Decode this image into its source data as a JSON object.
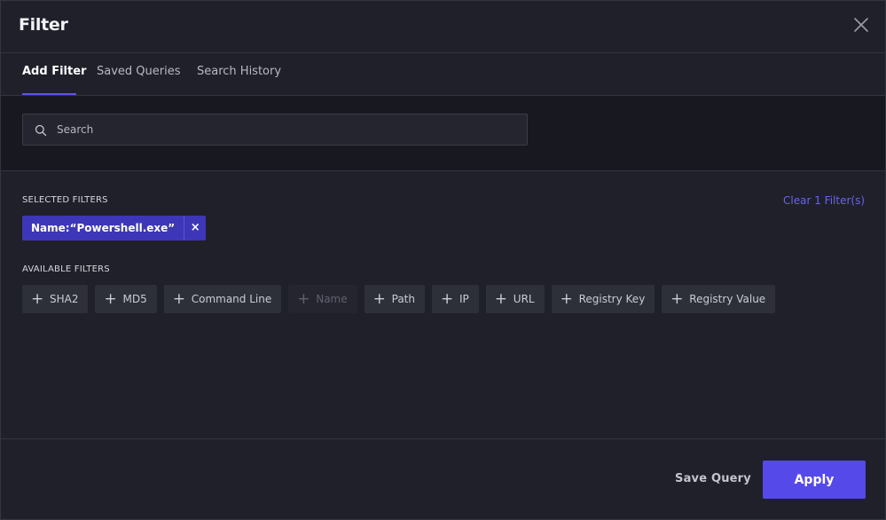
{
  "dialog": {
    "title": "Filter",
    "close_icon": "close-icon"
  },
  "tabs": [
    {
      "label": "Add Filter",
      "active": true
    },
    {
      "label": "Saved Queries",
      "active": false
    },
    {
      "label": "Search History",
      "active": false
    }
  ],
  "search": {
    "placeholder": "Search",
    "value": "",
    "icon": "search-icon"
  },
  "selected_filters": {
    "label": "SELECTED FILTERS",
    "clear_label": "Clear 1 Filter(s)",
    "items": [
      {
        "label": "Name:“Powershell.exe”",
        "remove_glyph": "×"
      }
    ]
  },
  "available_filters": {
    "label": "AVAILABLE FILTERS",
    "items": [
      {
        "label": "SHA2",
        "enabled": true
      },
      {
        "label": "MD5",
        "enabled": true
      },
      {
        "label": "Command Line",
        "enabled": true
      },
      {
        "label": "Name",
        "enabled": false
      },
      {
        "label": "Path",
        "enabled": true
      },
      {
        "label": "IP",
        "enabled": true
      },
      {
        "label": "URL",
        "enabled": true
      },
      {
        "label": "Registry Key",
        "enabled": true
      },
      {
        "label": "Registry Value",
        "enabled": true
      }
    ]
  },
  "footer": {
    "save_query_label": "Save Query",
    "apply_label": "Apply"
  },
  "colors": {
    "background": "#1f2029",
    "accent": "#5649ea",
    "chip": "#3e36b8",
    "link": "#6a62f3"
  }
}
